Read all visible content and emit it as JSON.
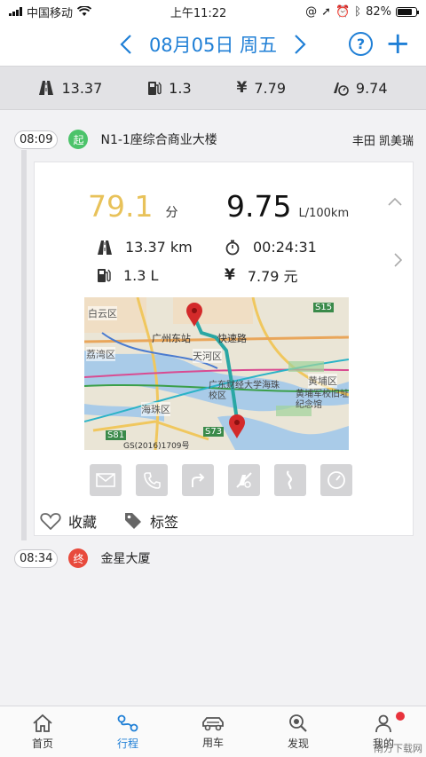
{
  "status_bar": {
    "carrier": "中国移动",
    "time": "上午11:22",
    "battery": "82%",
    "battery_level": 0.82
  },
  "nav": {
    "date": "08月05日 周五",
    "help": "?",
    "add": "+"
  },
  "summary": {
    "distance": "13.37",
    "fuel": "1.3",
    "cost": "7.79",
    "consumption": "9.74"
  },
  "trip": {
    "start": {
      "time": "08:09",
      "marker": "起",
      "name": "N1-1座综合商业大楼",
      "car": "丰田 凯美瑞",
      "color": "#4cc36a"
    },
    "score": "79.1",
    "score_unit": "分",
    "fuel_rate": "9.75",
    "fuel_rate_unit": "L/100km",
    "distance": "13.37 km",
    "duration": "00:24:31",
    "fuel_used": "1.3 L",
    "cost": "7.79 元",
    "map": {
      "labels": [
        "白云区",
        "广州东站",
        "快速路",
        "荔湾区",
        "天河区",
        "广东财经大学海珠校区",
        "黄埔区",
        "黄埔军校旧址纪念馆",
        "海珠区",
        "S15",
        "S81",
        "S73",
        "GS(2016)1709号"
      ]
    },
    "favorite_label": "收藏",
    "tag_label": "标签",
    "end": {
      "time": "08:34",
      "marker": "终",
      "name": "金星大厦",
      "color": "#e84a3c"
    }
  },
  "tabs": [
    {
      "label": "首页",
      "icon": "home-icon"
    },
    {
      "label": "行程",
      "icon": "route-icon"
    },
    {
      "label": "用车",
      "icon": "car-icon"
    },
    {
      "label": "发现",
      "icon": "discover-icon"
    },
    {
      "label": "我的",
      "icon": "profile-icon"
    }
  ],
  "watermark": "南方下载网"
}
